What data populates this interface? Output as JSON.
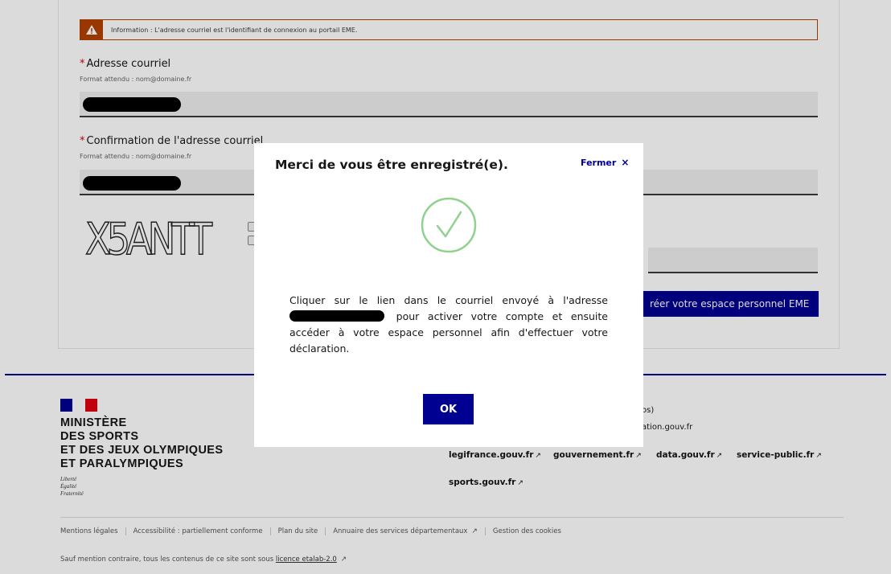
{
  "form": {
    "info_banner": "Information : L'adresse courriel est l'identifiant de connexion au portail EME.",
    "email_label": "Adresse courriel",
    "email_hint": "Format attendu : nom@domaine.fr",
    "confirm_label": "Confirmation de l'adresse courriel",
    "confirm_hint": "Format attendu : nom@domaine.fr",
    "captcha_text": "X5ANTT",
    "submit_label": "réer votre espace personnel EME",
    "required_mark": "*"
  },
  "footer": {
    "ministry_lines": [
      "MINISTÈRE",
      "DES SPORTS",
      "ET DES JEUX OLYMPIQUES",
      "ET PARALYMPIQUES"
    ],
    "devise": [
      "Liberté",
      "Égalité",
      "Fraternité"
    ],
    "partial_1": "os)",
    "partial_2": "ation.gouv.fr",
    "links": [
      "legifrance.gouv.fr",
      "gouvernement.fr",
      "data.gouv.fr",
      "service-public.fr",
      "sports.gouv.fr"
    ],
    "bottom_links": [
      "Mentions légales",
      "Accessibilité : partiellement conforme",
      "Plan du site",
      "Annuaire des services départementaux",
      "Gestion des cookies"
    ],
    "licence_prefix": "Sauf mention contraire, tous les contenus de ce site sont sous ",
    "licence_link": "licence etalab-2.0",
    "external_icon": "external-link-icon"
  },
  "modal": {
    "title": "Merci de vous être enregistré(e).",
    "close_label": "Fermer",
    "close_icon": "×",
    "text_before": "Cliquer sur le lien dans le courriel envoyé à l'adresse",
    "text_after": "pour activer votre compte et ensuite accéder à votre espace personnel afin d'effectuer votre déclaration.",
    "ok_label": "OK",
    "check_color": "#8fd18f"
  },
  "colors": {
    "primary": "#000091",
    "warning": "#b34000",
    "required": "#ce0500"
  }
}
